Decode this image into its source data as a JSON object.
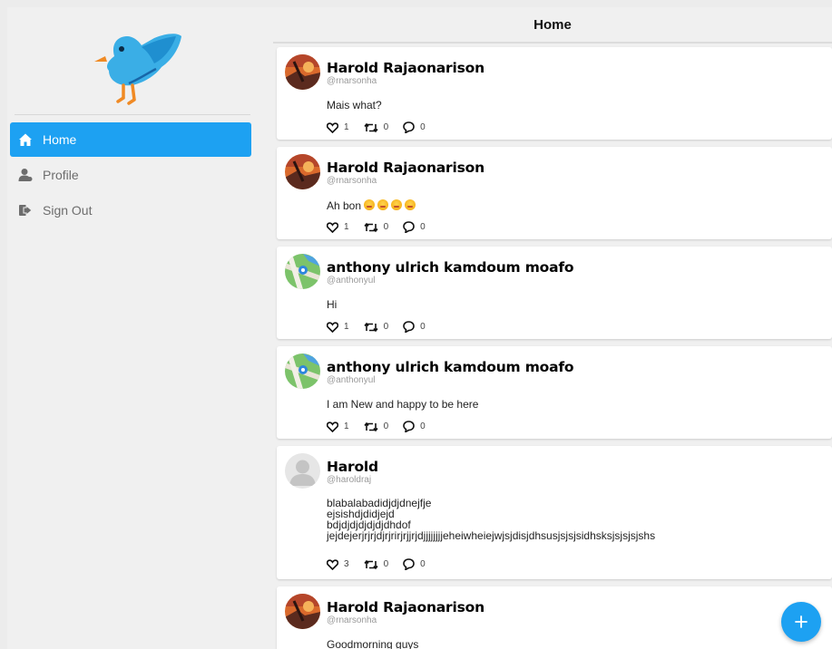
{
  "sidebar": {
    "items": [
      {
        "label": "Home",
        "icon": "home-icon",
        "active": true
      },
      {
        "label": "Profile",
        "icon": "user-icon",
        "active": false
      },
      {
        "label": "Sign Out",
        "icon": "sign-out-icon",
        "active": false
      }
    ]
  },
  "header": {
    "title": "Home"
  },
  "tweets": [
    {
      "name": "Harold Rajaonarison",
      "handle": "@rnarsonha",
      "text": "Mais what?",
      "likes": "1",
      "retweets": "0",
      "comments": "0",
      "avatar": "sunset-avatar"
    },
    {
      "name": "Harold Rajaonarison",
      "handle": "@rnarsonha",
      "text": "Ah bon",
      "emojis": "😩😩😩😩",
      "likes": "1",
      "retweets": "0",
      "comments": "0",
      "avatar": "sunset-avatar"
    },
    {
      "name": "anthony ulrich kamdoum moafo",
      "handle": "@anthonyul",
      "text": "Hi",
      "likes": "1",
      "retweets": "0",
      "comments": "0",
      "avatar": "map-avatar"
    },
    {
      "name": "anthony ulrich kamdoum moafo",
      "handle": "@anthonyul",
      "text": "I am New and happy to be here",
      "likes": "1",
      "retweets": "0",
      "comments": "0",
      "avatar": "map-avatar"
    },
    {
      "name": "Harold",
      "handle": "@haroldraj",
      "text": "blabalabadidjdjdnejfje\nejsishdjdidjejd\nbdjdjdjdjdjdjdhdof\njejdejerjrjrjdjrjrirjrjjrjdjjjjjjjjeheiwheiejwjsjdisjdhsusjsjsjsidhsksjsjsjsjshs",
      "likes": "3",
      "retweets": "0",
      "comments": "0",
      "avatar": "default-avatar"
    },
    {
      "name": "Harold Rajaonarison",
      "handle": "@rnarsonha",
      "text": "Goodmorning guys",
      "likes": "",
      "retweets": "",
      "comments": "",
      "avatar": "sunset-avatar"
    }
  ],
  "fab": {
    "icon": "plus-icon"
  },
  "colors": {
    "accent": "#1da1f2",
    "background": "#f0f0f0",
    "card": "#ffffff"
  }
}
